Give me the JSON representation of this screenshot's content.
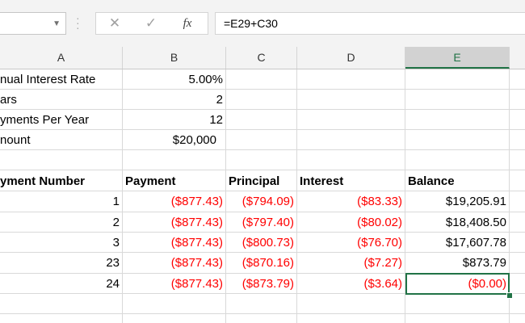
{
  "name_box": {
    "value": "",
    "dropdown_icon": "chevron-down-icon"
  },
  "formula_bar": {
    "cancel_icon": "close-icon",
    "enter_icon": "check-icon",
    "fx_label": "fx",
    "formula": "=E29+C30"
  },
  "columns": [
    "A",
    "B",
    "C",
    "D",
    "E"
  ],
  "selected_column": "E",
  "cells": {
    "a1": "nual Interest Rate",
    "b1": "5.00%",
    "a2": "ars",
    "b2": "2",
    "a3": "yments Per Year",
    "b3": "12",
    "a4": "nount",
    "b4": "$20,000",
    "headers": {
      "a": "yment Number",
      "b": "Payment",
      "c": "Principal",
      "d": "Interest",
      "e": "Balance"
    },
    "rows": [
      {
        "num": "1",
        "payment": "($877.43)",
        "principal": "($794.09)",
        "interest": "($83.33)",
        "balance": "$19,205.91"
      },
      {
        "num": "2",
        "payment": "($877.43)",
        "principal": "($797.40)",
        "interest": "($80.02)",
        "balance": "$18,408.50"
      },
      {
        "num": "3",
        "payment": "($877.43)",
        "principal": "($800.73)",
        "interest": "($76.70)",
        "balance": "$17,607.78"
      },
      {
        "num": "23",
        "payment": "($877.43)",
        "principal": "($870.16)",
        "interest": "($7.27)",
        "balance": "$873.79"
      },
      {
        "num": "24",
        "payment": "($877.43)",
        "principal": "($873.79)",
        "interest": "($3.64)",
        "balance": "($0.00)"
      }
    ]
  },
  "colors": {
    "negative": "#ff0000",
    "selection": "#217346"
  }
}
